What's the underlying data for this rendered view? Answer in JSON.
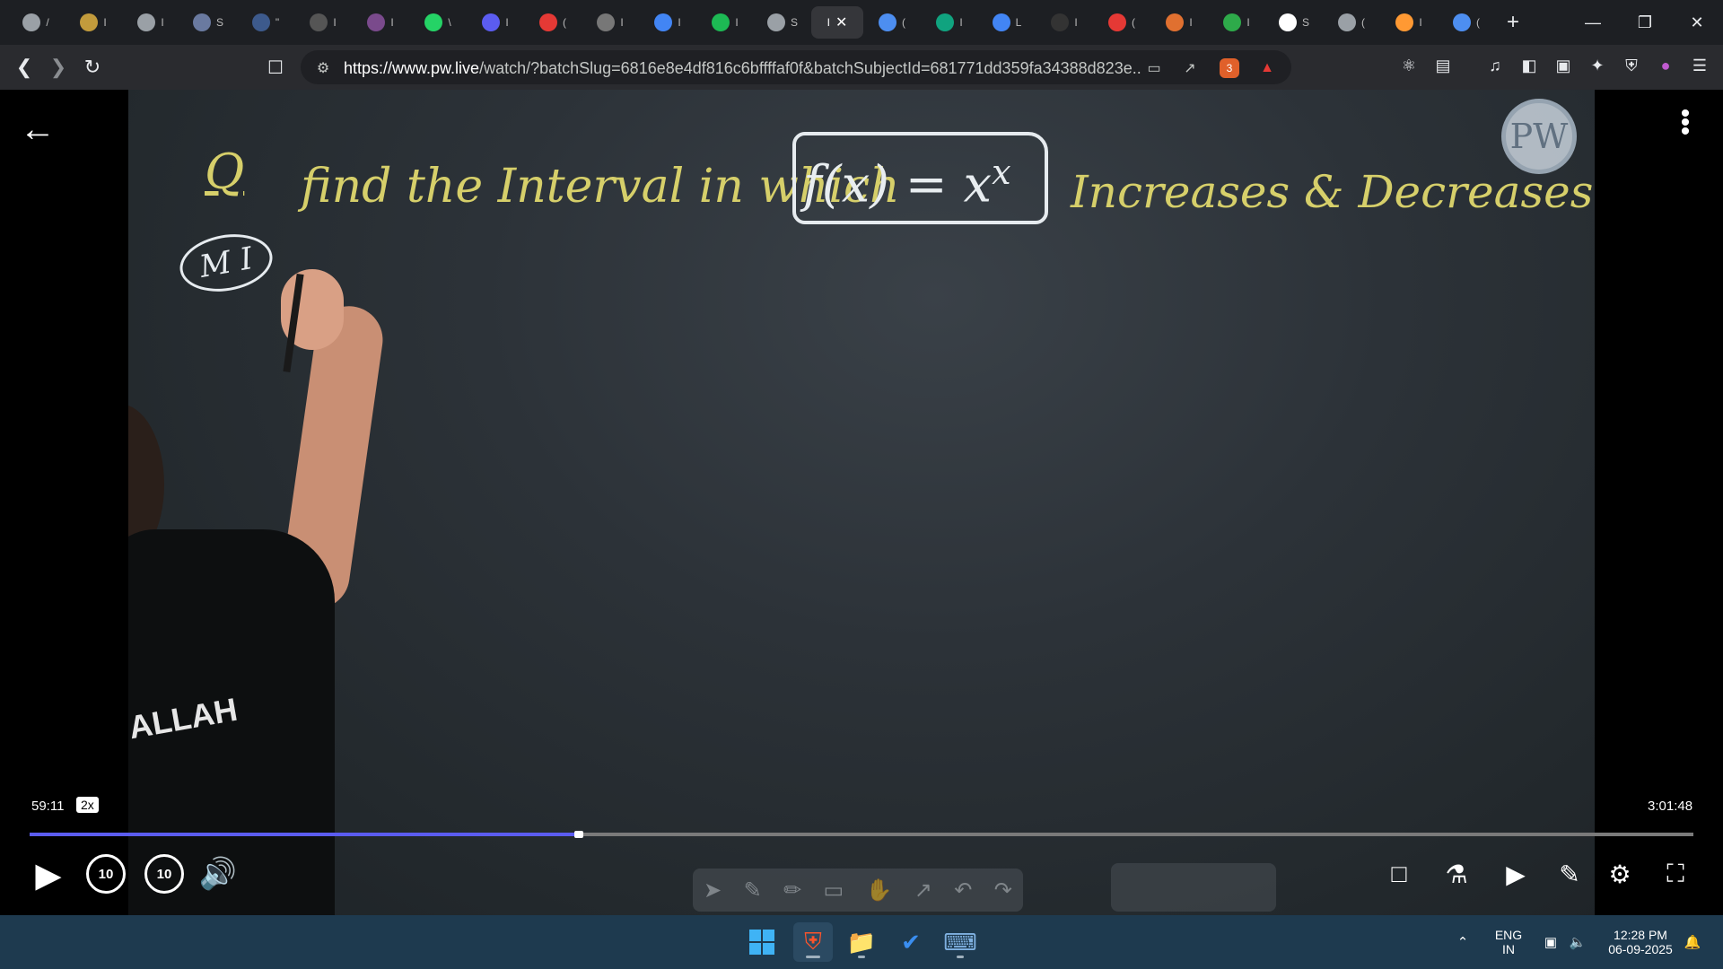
{
  "browser": {
    "tabs": [
      {
        "icon": "globe-icon",
        "color": "#9aa0a6",
        "cut": "/"
      },
      {
        "icon": "coin-icon",
        "color": "#c29b3c",
        "cut": "I"
      },
      {
        "icon": "globe-icon",
        "color": "#9aa0a6",
        "cut": "I"
      },
      {
        "icon": "globe-icon",
        "color": "#6a7aa0",
        "cut": "S"
      },
      {
        "icon": "w-icon",
        "color": "#3d5a8c",
        "cut": "\""
      },
      {
        "icon": "m4-icon",
        "color": "#555",
        "cut": "I"
      },
      {
        "icon": "avatar-icon",
        "color": "#7a4a8c",
        "cut": "I"
      },
      {
        "icon": "whatsapp-icon",
        "color": "#25d366",
        "cut": "\\"
      },
      {
        "icon": "bookmark-icon",
        "color": "#5b5cf0",
        "cut": "I"
      },
      {
        "icon": "youtube-icon",
        "color": "#e53935",
        "cut": "("
      },
      {
        "icon": "globe-icon",
        "color": "#777",
        "cut": "I"
      },
      {
        "icon": "google-icon",
        "color": "#4285f4",
        "cut": "I"
      },
      {
        "icon": "spotify-icon",
        "color": "#1db954",
        "cut": "I"
      },
      {
        "icon": "globe-icon",
        "color": "#9aa0a6",
        "cut": "S"
      },
      {
        "icon": "active-tab",
        "color": "#35363a",
        "cut": "I"
      },
      {
        "icon": "gemini-icon",
        "color": "#4d8ef0",
        "cut": "("
      },
      {
        "icon": "chatgpt-icon",
        "color": "#10a37f",
        "cut": "I"
      },
      {
        "icon": "google-icon",
        "color": "#4285f4",
        "cut": "L"
      },
      {
        "icon": "monitor-icon",
        "color": "#333",
        "cut": "I"
      },
      {
        "icon": "youtube-icon",
        "color": "#e53935",
        "cut": "("
      },
      {
        "icon": "globe-icon",
        "color": "#e07030",
        "cut": "I"
      },
      {
        "icon": "chart-icon",
        "color": "#2eaa4a",
        "cut": "I"
      },
      {
        "icon": "wikipedia-icon",
        "color": "#fff",
        "cut": "S"
      },
      {
        "icon": "globe-icon",
        "color": "#9aa0a6",
        "cut": "("
      },
      {
        "icon": "flag-icon",
        "color": "#ff9933",
        "cut": "I"
      },
      {
        "icon": "gemini-icon",
        "color": "#4d8ef0",
        "cut": "("
      }
    ],
    "url_domain": "https://www.pw.live",
    "url_path": "/watch/?batchSlug=6816e8e4df816c6bffffaf0f&batchSubjectId=681771dd359fa34388d823e...",
    "shield_badge": "3"
  },
  "board": {
    "q_label": "Q",
    "line_text": "find the Interval in which",
    "formula_base": "f(x) = x",
    "formula_exp": "x",
    "line_rest": "Increases & Decreases.",
    "method_label": "M I",
    "logo": "PW",
    "shirt_text": "ALLAH"
  },
  "player": {
    "current_time": "59:11",
    "speed": "2x",
    "total_time": "3:01:48",
    "progress_fraction": 0.33,
    "rewind_label": "10",
    "forward_label": "10"
  },
  "taskbar": {
    "lang": "ENG",
    "region": "IN",
    "time": "12:28 PM",
    "date": "06-09-2025"
  }
}
